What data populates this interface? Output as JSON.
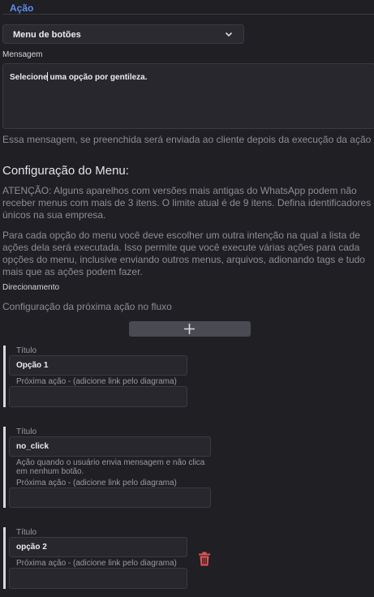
{
  "section": {
    "title": "Ação"
  },
  "action_type": {
    "value": "Menu de botões"
  },
  "message": {
    "label": "Mensagem",
    "value_before_cursor": "Selecione",
    "value_after_cursor": " uma opção por gentileza.",
    "help": "Essa mensagem, se preenchida será enviada ao cliente depois da execução da ação"
  },
  "menu_config": {
    "heading": "Configuração do Menu:",
    "warning": "ATENÇÃO: Alguns aparelhos com versões mais antigas do WhatsApp podem não receber menus com mais de 3 itens. O limite atual é de 9 itens. Defina identificadores únicos na sua empresa.",
    "description": "Para cada opção do menu você deve escolher um outra intenção na qual a lista de ações dela será executada. Isso permite que você execute várias ações para cada opções do menu, inclusive enviando outros menus, arquivos, adionando tags e tudo mais que as ações podem fazer."
  },
  "routing": {
    "label": "Direcionamento",
    "help": "Configuração da próxima ação no fluxo"
  },
  "options": [
    {
      "title_label": "Título",
      "title_value": "Opção 1",
      "next_label": "Próxima ação - (adicione link pelo diagrama)"
    },
    {
      "title_label": "Título",
      "title_value": "no_click",
      "note": "Ação quando o usuário envia mensagem e não clica em nenhum botão.",
      "next_label": "Próxima ação - (adicione link pelo diagrama)"
    },
    {
      "title_label": "Título",
      "title_value": "opção 2",
      "next_label": "Próxima ação - (adicione link pelo diagrama)"
    }
  ],
  "icons": {
    "chevron": "chevron-down-icon",
    "add": "plus-icon",
    "delete": "trash-icon"
  },
  "colors": {
    "accent": "#5e8ef0",
    "delete": "#e05555",
    "background": "#1f1f24"
  }
}
